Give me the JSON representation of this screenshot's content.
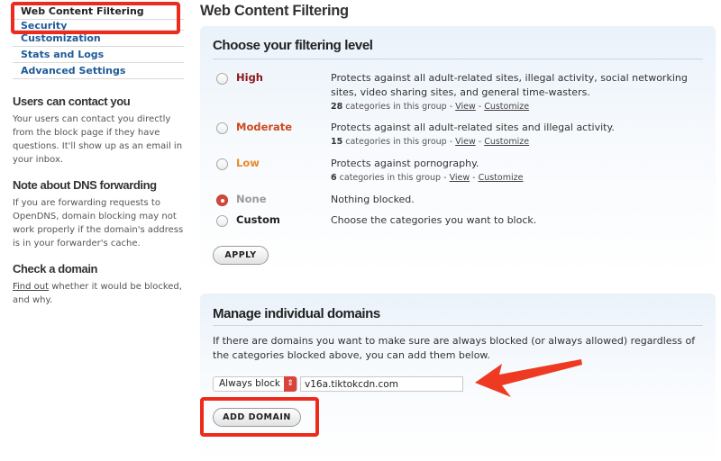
{
  "sidebar": {
    "nav": [
      {
        "label": "Web Content Filtering",
        "active": true
      },
      {
        "label": "Security",
        "active": false
      },
      {
        "label": "Customization",
        "active": false
      },
      {
        "label": "Stats and Logs",
        "active": false
      },
      {
        "label": "Advanced Settings",
        "active": false
      }
    ],
    "contact": {
      "heading": "Users can contact you",
      "text": "Your users can contact you directly from the block page if they have questions. It'll show up as an email in your inbox."
    },
    "dns": {
      "heading": "Note about DNS forwarding",
      "text": "If you are forwarding requests to OpenDNS, domain blocking may not work properly if the domain's address is in your forwarder's cache."
    },
    "check": {
      "heading": "Check a domain",
      "link": "Find out",
      "text": " whether it would be blocked, and why."
    }
  },
  "main": {
    "title": "Web Content Filtering",
    "filtering": {
      "heading": "Choose your filtering level",
      "options": [
        {
          "label": "High",
          "color": "#8b1a1a",
          "selected": false,
          "desc": "Protects against all adult-related sites, illegal activity, social networking sites, video sharing sites, and general time-wasters.",
          "count": "28",
          "meta": " categories in this group - ",
          "view": "View",
          "sep": " - ",
          "customize": "Customize"
        },
        {
          "label": "Moderate",
          "color": "#cc4a1e",
          "selected": false,
          "desc": "Protects against all adult-related sites and illegal activity.",
          "count": "15",
          "meta": " categories in this group - ",
          "view": "View",
          "sep": " - ",
          "customize": "Customize"
        },
        {
          "label": "Low",
          "color": "#e8892a",
          "selected": false,
          "desc": "Protects against pornography.",
          "count": "6",
          "meta": " categories in this group - ",
          "view": "View",
          "sep": " - ",
          "customize": "Customize"
        },
        {
          "label": "None",
          "color": "#9a9a9a",
          "selected": true,
          "desc": "Nothing blocked."
        },
        {
          "label": "Custom",
          "color": "#222222",
          "selected": false,
          "desc": "Choose the categories you want to block."
        }
      ],
      "apply_label": "APPLY"
    },
    "domains": {
      "heading": "Manage individual domains",
      "desc": "If there are domains you want to make sure are always blocked (or always allowed) regardless of the categories blocked above, you can add them below.",
      "select_value": "Always block",
      "domain_value": "v16a.tiktokcdn.com",
      "add_label": "ADD DOMAIN"
    }
  },
  "annotations": {
    "highlight_color": "#ee2a1c"
  }
}
